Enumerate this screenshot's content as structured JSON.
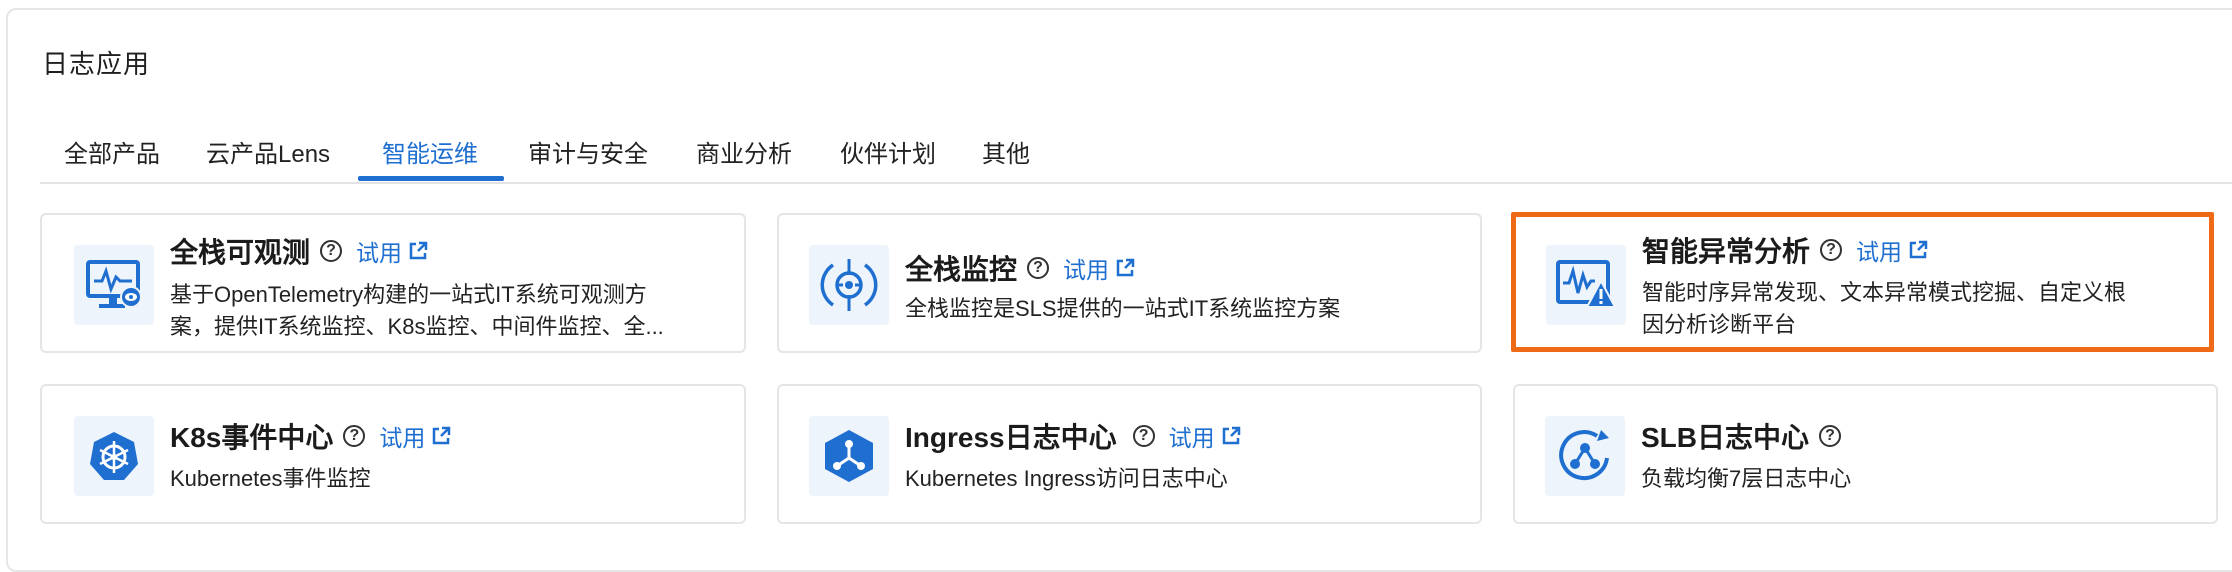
{
  "section": {
    "title": "日志应用"
  },
  "tabs": [
    {
      "label": "全部产品"
    },
    {
      "label": "云产品Lens"
    },
    {
      "label": "智能运维"
    },
    {
      "label": "审计与安全"
    },
    {
      "label": "商业分析"
    },
    {
      "label": "伙伴计划"
    },
    {
      "label": "其他"
    }
  ],
  "active_tab_index": 2,
  "cards": [
    {
      "title": "全栈可观测",
      "try_label": "试用",
      "desc_line1": "基于OpenTelemetry构建的一站式IT系统可观测方",
      "desc_line2": "案，提供IT系统监控、K8s监控、中间件监控、全...",
      "icon": "observability-monitor-icon"
    },
    {
      "title": "全栈监控",
      "try_label": "试用",
      "desc_line1": "全栈监控是SLS提供的一站式IT系统监控方案",
      "icon": "target-monitor-icon"
    },
    {
      "title": "智能异常分析",
      "try_label": "试用",
      "desc_line1": "智能时序异常发现、文本异常模式挖掘、自定义根",
      "desc_line2": "因分析诊断平台",
      "icon": "anomaly-chart-warning-icon"
    },
    {
      "title": "K8s事件中心",
      "try_label": "试用",
      "desc_line1": "Kubernetes事件监控",
      "icon": "kubernetes-helm-icon"
    },
    {
      "title": "Ingress日志中心",
      "try_label": "试用",
      "desc_line1": "Kubernetes Ingress访问日志中心",
      "icon": "ingress-hexagon-icon"
    },
    {
      "title": "SLB日志中心",
      "desc_line1": "负载均衡7层日志中心",
      "icon": "slb-circle-network-icon"
    }
  ],
  "colors": {
    "accent": "#1f6fd1",
    "highlight_border": "#ef6a16",
    "icon_bg": "#eef4fc"
  }
}
